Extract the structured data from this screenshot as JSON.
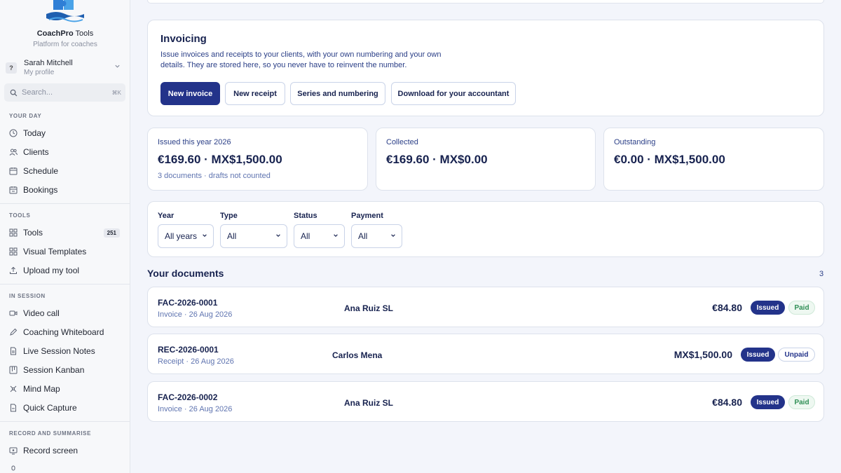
{
  "sidebar": {
    "brand_bold": "CoachPro",
    "brand_rest": " Tools",
    "brand_sub": "Platform for coaches",
    "profile": {
      "initial": "?",
      "name": "Sarah Mitchell",
      "sub": "My profile"
    },
    "search": {
      "placeholder": "Search...",
      "shortcut": "⌘K"
    },
    "sections": {
      "your_day": "YOUR DAY",
      "tools": "TOOLS",
      "in_session": "IN SESSION",
      "record": "RECORD AND SUMMARISE"
    },
    "items": {
      "today": "Today",
      "clients": "Clients",
      "schedule": "Schedule",
      "bookings": "Bookings",
      "tools": "Tools",
      "tools_count": "251",
      "visual_templates": "Visual Templates",
      "upload": "Upload my tool",
      "video_call": "Video call",
      "whiteboard": "Coaching Whiteboard",
      "notes": "Live Session Notes",
      "kanban": "Session Kanban",
      "mindmap": "Mind Map",
      "capture": "Quick Capture",
      "record_screen": "Record screen"
    }
  },
  "invoicing": {
    "title": "Invoicing",
    "description": "Issue invoices and receipts to your clients, with your own numbering and your own details. They are stored here, so you never have to reinvent the number.",
    "buttons": {
      "new_invoice": "New invoice",
      "new_receipt": "New receipt",
      "series": "Series and numbering",
      "download": "Download for your accountant"
    }
  },
  "stats": [
    {
      "label": "Issued this year 2026",
      "value": "€169.60 · MX$1,500.00",
      "note": "3 documents · drafts not counted"
    },
    {
      "label": "Collected",
      "value": "€169.60 · MX$0.00",
      "note": ""
    },
    {
      "label": "Outstanding",
      "value": "€0.00 · MX$1,500.00",
      "note": ""
    }
  ],
  "filters": {
    "year": {
      "label": "Year",
      "value": "All years"
    },
    "type": {
      "label": "Type",
      "value": "All"
    },
    "status": {
      "label": "Status",
      "value": "All"
    },
    "payment": {
      "label": "Payment",
      "value": "All"
    }
  },
  "documents": {
    "title": "Your documents",
    "count": "3",
    "rows": [
      {
        "id": "FAC-2026-0001",
        "meta": "Invoice · 26 Aug 2026",
        "client": "Ana Ruiz SL",
        "amount": "€84.80",
        "status": "Issued",
        "payment": "Paid"
      },
      {
        "id": "REC-2026-0001",
        "meta": "Receipt · 26 Aug 2026",
        "client": "Carlos Mena",
        "amount": "MX$1,500.00",
        "status": "Issued",
        "payment": "Unpaid"
      },
      {
        "id": "FAC-2026-0002",
        "meta": "Invoice · 26 Aug 2026",
        "client": "Ana Ruiz SL",
        "amount": "€84.80",
        "status": "Issued",
        "payment": "Paid"
      }
    ]
  }
}
